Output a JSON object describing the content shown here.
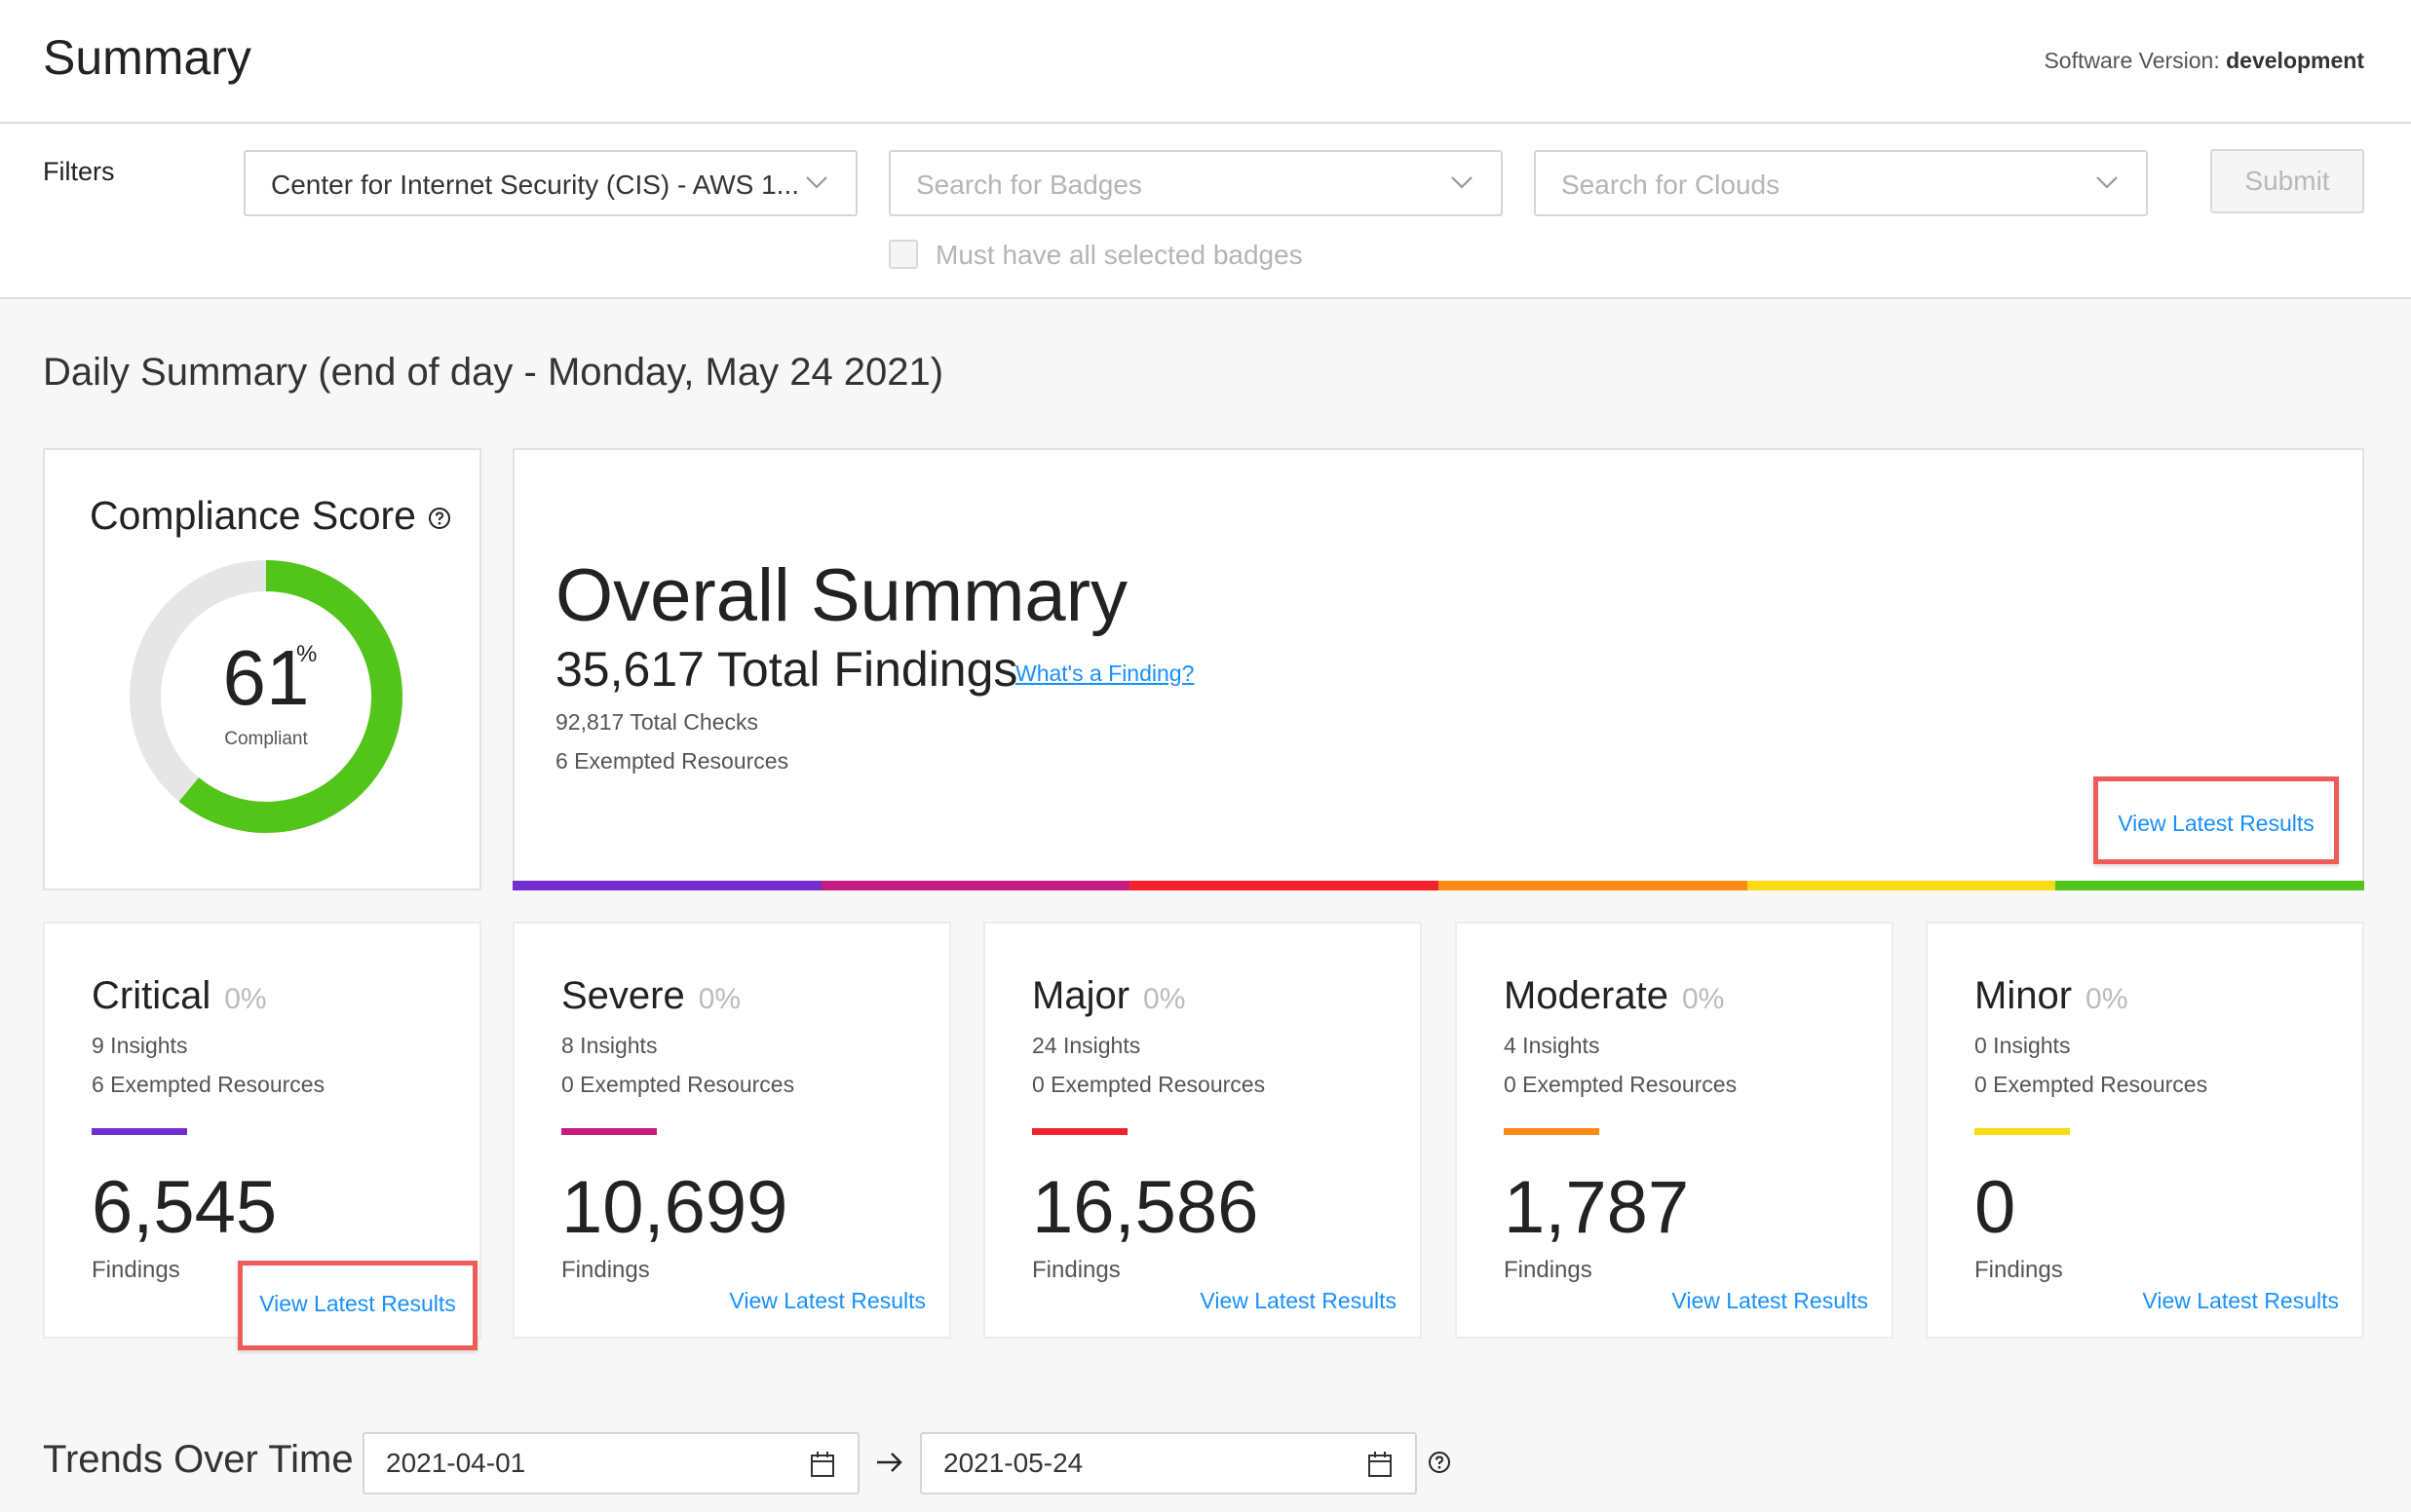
{
  "header": {
    "title": "Summary",
    "version_label": "Software Version:",
    "version_value": "development"
  },
  "filters": {
    "label": "Filters",
    "framework_value": "Center for Internet Security (CIS) - AWS 1....",
    "badges_placeholder": "Search for Badges",
    "clouds_placeholder": "Search for Clouds",
    "submit_label": "Submit",
    "must_have_all_label": "Must have all selected badges",
    "must_have_all_checked": false
  },
  "daily": {
    "title": "Daily Summary (end of day - Monday, May 24 2021)"
  },
  "compliance": {
    "title": "Compliance Score",
    "value": "61",
    "percent_sign": "%",
    "label": "Compliant",
    "fraction": 0.61,
    "color_fill": "#52c41a",
    "color_track": "#e6e6e6"
  },
  "overall": {
    "title": "Overall Summary",
    "total_findings": "35,617 Total Findings",
    "finding_link": "What's a Finding?",
    "total_checks": "92,817 Total Checks",
    "exempted": "6 Exempted Resources",
    "view_link": "View Latest Results",
    "bar_colors": [
      "#722ed1",
      "#c41d7f",
      "#f5222d",
      "#fa8c16",
      "#fadb14",
      "#52c41a"
    ]
  },
  "severities": [
    {
      "name": "Critical",
      "pct": "0%",
      "insights": "9 Insights",
      "exempted": "6 Exempted Resources",
      "findings": "6,545",
      "findings_label": "Findings",
      "link": "View Latest Results",
      "color": "#722ed1"
    },
    {
      "name": "Severe",
      "pct": "0%",
      "insights": "8 Insights",
      "exempted": "0 Exempted Resources",
      "findings": "10,699",
      "findings_label": "Findings",
      "link": "View Latest Results",
      "color": "#c41d7f"
    },
    {
      "name": "Major",
      "pct": "0%",
      "insights": "24 Insights",
      "exempted": "0 Exempted Resources",
      "findings": "16,586",
      "findings_label": "Findings",
      "link": "View Latest Results",
      "color": "#f5222d"
    },
    {
      "name": "Moderate",
      "pct": "0%",
      "insights": "4 Insights",
      "exempted": "0 Exempted Resources",
      "findings": "1,787",
      "findings_label": "Findings",
      "link": "View Latest Results",
      "color": "#fa8c16"
    },
    {
      "name": "Minor",
      "pct": "0%",
      "insights": "0 Insights",
      "exempted": "0 Exempted Resources",
      "findings": "0",
      "findings_label": "Findings",
      "link": "View Latest Results",
      "color": "#fadb14"
    }
  ],
  "trends": {
    "title": "Trends Over Time",
    "start_date": "2021-04-01",
    "end_date": "2021-05-24"
  },
  "icons": {
    "select_chevron": "chevron-down-icon",
    "help": "question-circle-icon",
    "calendar": "calendar-icon",
    "arrow": "arrow-right-icon"
  }
}
